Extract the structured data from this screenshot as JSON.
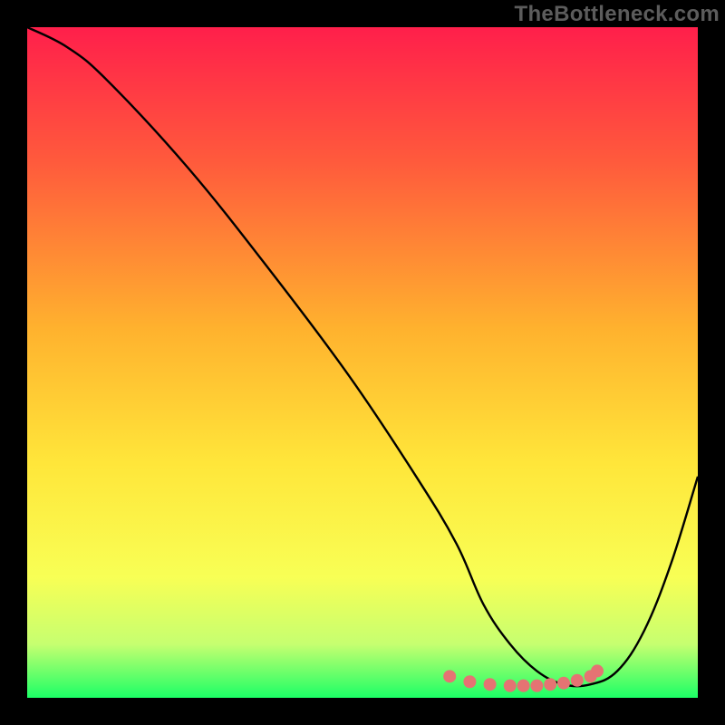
{
  "watermark": "TheBottleneck.com",
  "chart_data": {
    "type": "line",
    "title": "",
    "xlabel": "",
    "ylabel": "",
    "xlim": [
      0,
      100
    ],
    "ylim": [
      0,
      100
    ],
    "grid": false,
    "legend": false,
    "gradient_stops": [
      {
        "offset": 0,
        "color": "#ff1f4b"
      },
      {
        "offset": 20,
        "color": "#ff5a3c"
      },
      {
        "offset": 45,
        "color": "#ffb22e"
      },
      {
        "offset": 65,
        "color": "#ffe63a"
      },
      {
        "offset": 82,
        "color": "#f8ff55"
      },
      {
        "offset": 92,
        "color": "#c6ff70"
      },
      {
        "offset": 100,
        "color": "#1cff66"
      }
    ],
    "series": [
      {
        "name": "bottleneck-curve",
        "color": "#000000",
        "x": [
          0,
          6,
          12,
          24,
          36,
          48,
          58,
          64,
          68,
          72,
          76,
          80,
          84,
          88,
          92,
          96,
          100
        ],
        "values": [
          100,
          97,
          92,
          79,
          64,
          48,
          33,
          23,
          14,
          8,
          4,
          2,
          2,
          4,
          10,
          20,
          33
        ]
      }
    ],
    "markers": {
      "name": "trough-markers",
      "color": "#e57373",
      "radius": 7,
      "x": [
        63,
        66,
        69,
        72,
        74,
        76,
        78,
        80,
        82,
        84,
        85
      ],
      "values": [
        3.2,
        2.4,
        2.0,
        1.8,
        1.8,
        1.8,
        2.0,
        2.2,
        2.6,
        3.2,
        4.0
      ]
    }
  }
}
